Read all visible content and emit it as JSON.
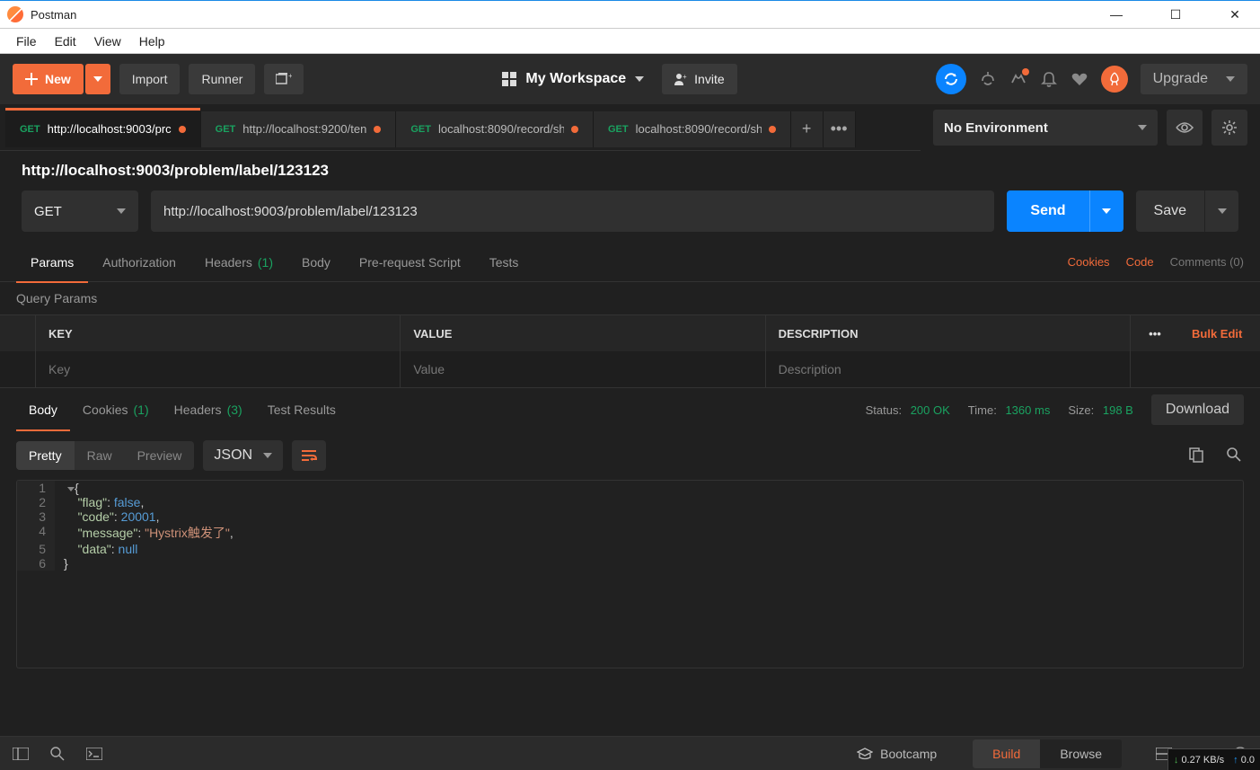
{
  "window": {
    "title": "Postman"
  },
  "osmenu": [
    "File",
    "Edit",
    "View",
    "Help"
  ],
  "toolbar": {
    "new_label": "New",
    "import_label": "Import",
    "runner_label": "Runner",
    "workspace_label": "My Workspace",
    "invite_label": "Invite",
    "upgrade_label": "Upgrade"
  },
  "tabs": [
    {
      "method": "GET",
      "label": "http://localhost:9003/prc",
      "dirty": true,
      "active": true
    },
    {
      "method": "GET",
      "label": "http://localhost:9200/ten",
      "dirty": true,
      "active": false
    },
    {
      "method": "GET",
      "label": "localhost:8090/record/sh",
      "dirty": true,
      "active": false
    },
    {
      "method": "GET",
      "label": "localhost:8090/record/sh",
      "dirty": true,
      "active": false
    }
  ],
  "environment": {
    "selected": "No Environment"
  },
  "request": {
    "title": "http://localhost:9003/problem/label/123123",
    "method": "GET",
    "url": "http://localhost:9003/problem/label/123123",
    "send_label": "Send",
    "save_label": "Save"
  },
  "req_tabs": {
    "params": "Params",
    "authorization": "Authorization",
    "headers": "Headers",
    "headers_count": "(1)",
    "body": "Body",
    "prerequest": "Pre-request Script",
    "tests": "Tests",
    "cookies": "Cookies",
    "code": "Code",
    "comments": "Comments (0)"
  },
  "params": {
    "section_label": "Query Params",
    "head": {
      "key": "KEY",
      "value": "VALUE",
      "description": "DESCRIPTION",
      "bulk": "Bulk Edit"
    },
    "placeholders": {
      "key": "Key",
      "value": "Value",
      "description": "Description"
    }
  },
  "resp_tabs": {
    "body": "Body",
    "cookies": "Cookies",
    "cookies_count": "(1)",
    "headers": "Headers",
    "headers_count": "(3)",
    "tests": "Test Results"
  },
  "resp_meta": {
    "status_label": "Status:",
    "status_value": "200 OK",
    "time_label": "Time:",
    "time_value": "1360 ms",
    "size_label": "Size:",
    "size_value": "198 B",
    "download": "Download"
  },
  "resp_toolbar": {
    "pretty": "Pretty",
    "raw": "Raw",
    "preview": "Preview",
    "format": "JSON"
  },
  "code_lines": [
    "1",
    "2",
    "3",
    "4",
    "5",
    "6"
  ],
  "json_body": {
    "flag_key": "\"flag\"",
    "flag_val": "false",
    "code_key": "\"code\"",
    "code_val": "20001",
    "msg_key": "\"message\"",
    "msg_val": "\"Hystrix触发了\"",
    "data_key": "\"data\"",
    "data_val": "null"
  },
  "status_bar": {
    "bootcamp": "Bootcamp",
    "build": "Build",
    "browse": "Browse"
  },
  "net": {
    "down": "0.27 KB/s",
    "up": "0.0"
  }
}
